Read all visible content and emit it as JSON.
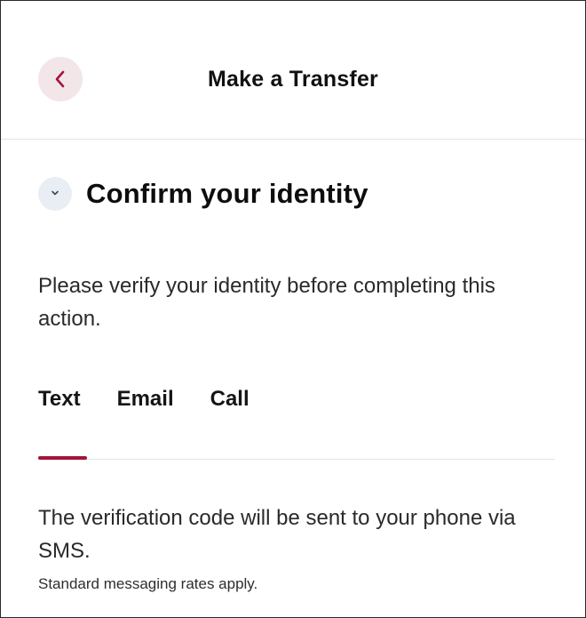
{
  "header": {
    "title": "Make a Transfer",
    "back_icon": "chevron-left-icon",
    "accent_color": "#a3153a"
  },
  "section": {
    "toggle_icon": "chevron-down-icon",
    "title": "Confirm your identity",
    "intro": "Please verify your identity before completing this action."
  },
  "tabs": {
    "items": [
      {
        "label": "Text",
        "selected": true
      },
      {
        "label": "Email",
        "selected": false
      },
      {
        "label": "Call",
        "selected": false
      }
    ],
    "indicator_color": "#a3153a"
  },
  "content": {
    "message": "The verification code will be sent to your phone via SMS.",
    "note": "Standard messaging rates apply."
  }
}
